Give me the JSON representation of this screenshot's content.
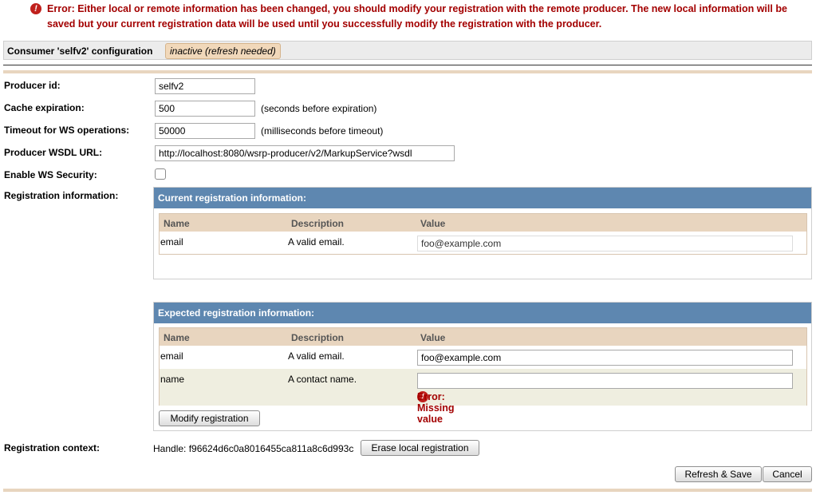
{
  "global_error": {
    "text": "Error: Either local or remote information has been changed, you should modify your registration with the remote producer. The new local information will be saved but your current registration data will be used until you successfully modify the registration with the producer."
  },
  "consumer": {
    "title": "Consumer 'selfv2' configuration",
    "status": "inactive (refresh needed)"
  },
  "form": {
    "producer_id": {
      "label": "Producer id:",
      "value": "selfv2"
    },
    "cache_expiration": {
      "label": "Cache expiration:",
      "value": "500",
      "hint": "(seconds before expiration)"
    },
    "timeout": {
      "label": "Timeout for WS operations:",
      "value": "50000",
      "hint": "(milliseconds before timeout)"
    },
    "wsdl_url": {
      "label": "Producer WSDL URL:",
      "value": "http://localhost:8080/wsrp-producer/v2/MarkupService?wsdl"
    },
    "ws_security": {
      "label": "Enable WS Security:",
      "checked": false
    },
    "registration_info_label": "Registration information:"
  },
  "current_registration": {
    "title": "Current registration information:",
    "columns": [
      "Name",
      "Description",
      "Value"
    ],
    "rows": [
      {
        "name": "email",
        "description": "A valid email.",
        "value": "foo@example.com"
      }
    ]
  },
  "expected_registration": {
    "title": "Expected registration information:",
    "columns": [
      "Name",
      "Description",
      "Value"
    ],
    "rows": [
      {
        "name": "email",
        "description": "A valid email.",
        "value": "foo@example.com"
      },
      {
        "name": "name",
        "description": "A contact name.",
        "value": "",
        "error": "Error: Missing value"
      }
    ],
    "modify_button": "Modify registration"
  },
  "registration_context": {
    "label": "Registration context:",
    "handle": "Handle: f96624d6c0a8016455ca811a8c6d993c",
    "erase_button": "Erase local registration"
  },
  "actions": {
    "refresh_save": "Refresh & Save",
    "cancel": "Cancel"
  },
  "colors": {
    "error": "#a30000",
    "panel_header": "#5e87b0",
    "table_header": "#e8d5bf",
    "status_badge": "#f1d8ba"
  }
}
